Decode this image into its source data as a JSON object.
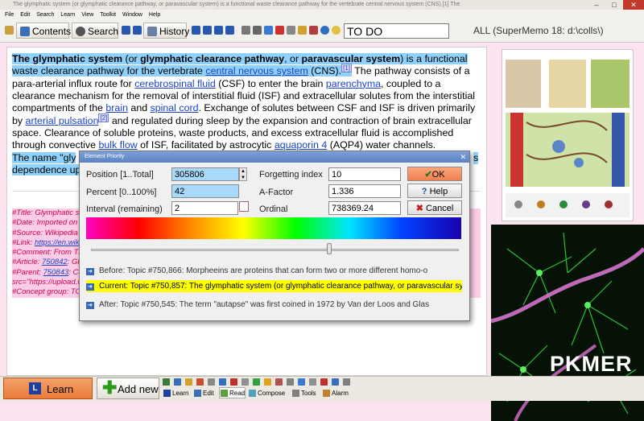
{
  "window": {
    "title": "The glymphatic system (or glymphatic clearance pathway, or paravascular system) is a functional waste clearance pathway for the vertebrate central nervous system (CNS).[1] The"
  },
  "menu": [
    "File",
    "Edit",
    "Search",
    "Learn",
    "View",
    "Toolkit",
    "Window",
    "Help"
  ],
  "toolbar": {
    "contents": "Contents",
    "search": "Search",
    "history": "History",
    "todo": "TO DO",
    "collection": "ALL (SuperMemo 18: d:\\colls\\)"
  },
  "article": {
    "p1_b1": "The",
    "p1_b2": "glymphatic system",
    "p1_t1": "(or",
    "p1_b3": "glymphatic clearance pathway",
    "p1_t2": ", or",
    "p1_b4": "paravascular system",
    "p1_t3": ") is a functional waste clearance pathway for the vertebrate",
    "link_cns": "central nervous system",
    "p1_t4": "(CNS).",
    "ref1": "[1]",
    "p1_t5": "The pathway consists of a para-arterial influx route for",
    "link_csf": "cerebrospinal fluid",
    "p1_t6": "(CSF) to enter the brain",
    "link_parenchyma": "parenchyma",
    "p1_t7": ", coupled to a clearance mechanism for the removal of interstitial fluid (ISF) and extracellular solutes from the interstitial compartments of the",
    "link_brain": "brain",
    "p1_t8": "and",
    "link_spinal": "spinal cord",
    "p1_t9": ". Exchange of solutes between CSF and ISF is driven primarily by",
    "link_arterial": "arterial pulsation",
    "ref2": "[2]",
    "p1_t10": "and regulated during sleep by the expansion and contraction of brain extracellular space. Clearance of soluble proteins, waste products, and excess extracellular fluid is accomplished through convective",
    "link_bulk": "bulk flow",
    "p1_t11": "of ISF, facilitated by astrocytic",
    "link_aqp4": "aquaporin 4",
    "p1_t12": "(AQP4) water channels.",
    "p2_a": "The name \"gly",
    "p2_b": "s",
    "p2_c": "dependence upo"
  },
  "refs": {
    "title": "#Title: Glymphatic sy",
    "date": "#Date: Imported on A",
    "source": "#Source: Wikipedia",
    "link_label": "#Link:",
    "link_url": "https://en.wiki",
    "comment": "#Comment: From Tit",
    "article_label": "#Article:",
    "article_id": "750842",
    "article_rest": ": Gly",
    "parent_label": "#Parent:",
    "parent_id": "750843",
    "parent_rest": ": Co",
    "src": "src=\"https://upload.w",
    "concept": "#Concept group: TO"
  },
  "dialog": {
    "title": "Element Priority",
    "position_label": "Position [1..Total]",
    "position_value": "305806",
    "percent_label": "Percent [0..100%]",
    "percent_value": "42",
    "interval_label": "Interval (remaining)",
    "interval_value": "2",
    "forgetting_label": "Forgetting index",
    "forgetting_value": "10",
    "afactor_label": "A-Factor",
    "afactor_value": "1.336",
    "ordinal_label": "Ordinal",
    "ordinal_value": "738369.24",
    "ok": "OK",
    "help": "Help",
    "cancel": "Cancel",
    "slider_percent": 42,
    "before": "Before: Topic #750,866: Morpheeins are proteins that can form two or more different homo-o",
    "current": "Current: Topic #750,857: The glymphatic system (or glymphatic clearance pathway, or paravascular system) is a func",
    "after": "After: Topic #750,545: The term \"autapse\" was first coined in 1972 by Van der Loos and Glas"
  },
  "bottom": {
    "learn": "Learn",
    "new": "Add new",
    "tabs": [
      "Learn",
      "Edit",
      "Read",
      "Compose",
      "Tools",
      "Alarm"
    ]
  },
  "watermark": "PKMER"
}
